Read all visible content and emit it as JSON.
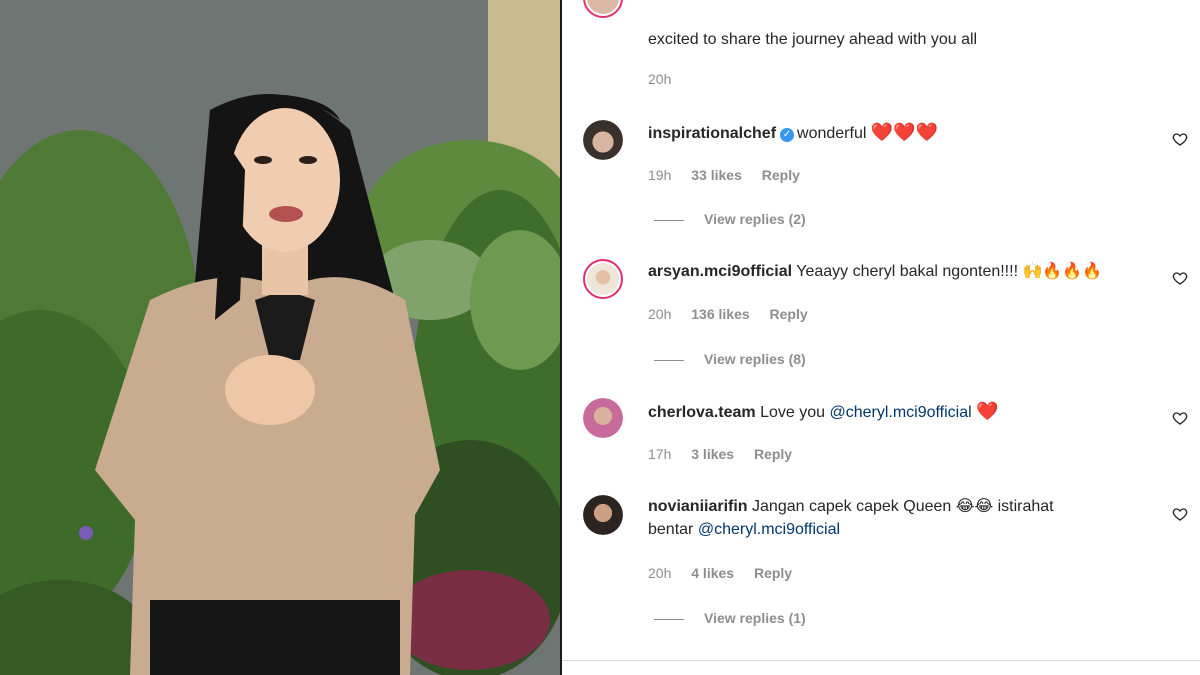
{
  "post": {
    "caption_tail": "excited to share the journey ahead with you all",
    "caption_time": "20h"
  },
  "comments": [
    {
      "username": "inspirationalchef",
      "verified": true,
      "text": "wonderful",
      "emoji": "❤️❤️❤️",
      "time": "19h",
      "likes": "33 likes",
      "reply": "Reply",
      "view_replies": "View replies (2)"
    },
    {
      "username": "arsyan.mci9official",
      "text": "Yeaayy cheryl bakal ngonten!!!!",
      "emoji": "🙌🔥🔥🔥",
      "time": "20h",
      "likes": "136 likes",
      "reply": "Reply",
      "view_replies": "View replies (8)"
    },
    {
      "username": "cherlova.team",
      "text": "Love you",
      "mention": "@cheryl.mci9official",
      "emoji": "❤️",
      "time": "17h",
      "likes": "3 likes",
      "reply": "Reply"
    },
    {
      "username": "novianiiarifin",
      "text": "Jangan capek capek Queen",
      "emoji": "😂😂",
      "text2": "istirahat",
      "line2_text": "bentar",
      "mention": "@cheryl.mci9official",
      "time": "20h",
      "likes": "4 likes",
      "reply": "Reply",
      "view_replies": "View replies (1)"
    }
  ],
  "icons": {
    "like": "heart-outline-icon",
    "verified": "verified-badge-icon"
  },
  "colors": {
    "mention": "#00376b",
    "verified": "#3897f0",
    "heart": "#e0162b",
    "meta": "#8e8e8e"
  }
}
